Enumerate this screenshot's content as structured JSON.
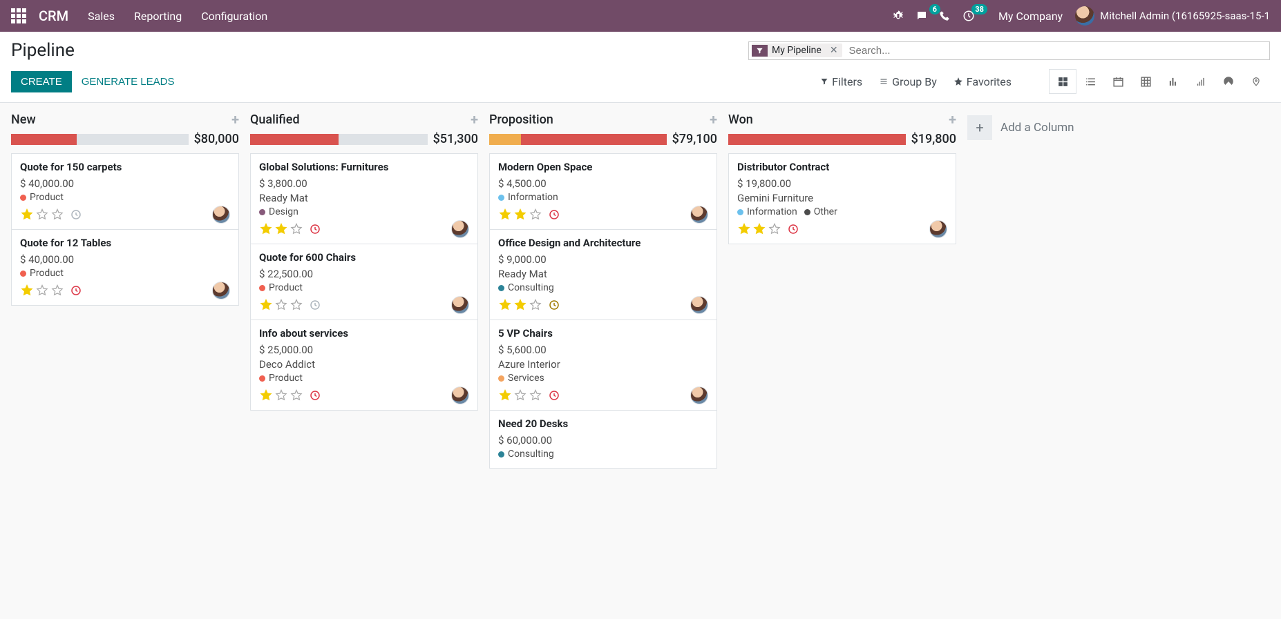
{
  "nav": {
    "brand": "CRM",
    "menus": [
      "Sales",
      "Reporting",
      "Configuration"
    ],
    "messages_badge": "6",
    "activities_badge": "38",
    "company": "My Company",
    "user": "Mitchell Admin (16165925-saas-15-1"
  },
  "control": {
    "title": "Pipeline",
    "create": "CREATE",
    "generate": "GENERATE LEADS",
    "facet_label": "My Pipeline",
    "search_placeholder": "Search...",
    "filters": "Filters",
    "groupby": "Group By",
    "favorites": "Favorites"
  },
  "add_column_label": "Add a Column",
  "tag_colors": {
    "Product": "#f06050",
    "Design": "#875a7b",
    "Information": "#6cc1ed",
    "Consulting": "#2c8397",
    "Services": "#f4a460",
    "Other": "#4c4c4c"
  },
  "columns": [
    {
      "title": "New",
      "amount": "$80,000",
      "progress": [
        {
          "color": "#d9534f",
          "pct": 37
        }
      ],
      "cards": [
        {
          "title": "Quote for 150 carpets",
          "amount": "$ 40,000.00",
          "company": null,
          "tags": [
            "Product"
          ],
          "stars": 1,
          "activity": "grey",
          "avatar": true
        },
        {
          "title": "Quote for 12 Tables",
          "amount": "$ 40,000.00",
          "company": null,
          "tags": [
            "Product"
          ],
          "stars": 1,
          "activity": "red",
          "avatar": true
        }
      ]
    },
    {
      "title": "Qualified",
      "amount": "$51,300",
      "progress": [
        {
          "color": "#d9534f",
          "pct": 50
        }
      ],
      "cards": [
        {
          "title": "Global Solutions: Furnitures",
          "amount": "$ 3,800.00",
          "company": "Ready Mat",
          "tags": [
            "Design"
          ],
          "stars": 2,
          "activity": "red",
          "avatar": true
        },
        {
          "title": "Quote for 600 Chairs",
          "amount": "$ 22,500.00",
          "company": null,
          "tags": [
            "Product"
          ],
          "stars": 1,
          "activity": "grey",
          "avatar": true
        },
        {
          "title": "Info about services",
          "amount": "$ 25,000.00",
          "company": "Deco Addict",
          "tags": [
            "Product"
          ],
          "stars": 1,
          "activity": "red",
          "avatar": true
        }
      ]
    },
    {
      "title": "Proposition",
      "amount": "$79,100",
      "progress": [
        {
          "color": "#f0ad4e",
          "pct": 18
        },
        {
          "color": "#d9534f",
          "pct": 82
        }
      ],
      "cards": [
        {
          "title": "Modern Open Space",
          "amount": "$ 4,500.00",
          "company": null,
          "tags": [
            "Information"
          ],
          "stars": 2,
          "activity": "red",
          "avatar": true
        },
        {
          "title": "Office Design and Architecture",
          "amount": "$ 9,000.00",
          "company": "Ready Mat",
          "tags": [
            "Consulting"
          ],
          "stars": 2,
          "activity": "amber",
          "avatar": true
        },
        {
          "title": "5 VP Chairs",
          "amount": "$ 5,600.00",
          "company": "Azure Interior",
          "tags": [
            "Services"
          ],
          "stars": 1,
          "activity": "red",
          "avatar": true
        },
        {
          "title": "Need 20 Desks",
          "amount": "$ 60,000.00",
          "company": null,
          "tags": [
            "Consulting"
          ],
          "stars": 0,
          "activity": null,
          "avatar": false,
          "partial": true
        }
      ]
    },
    {
      "title": "Won",
      "amount": "$19,800",
      "progress": [
        {
          "color": "#d9534f",
          "pct": 100
        }
      ],
      "cards": [
        {
          "title": "Distributor Contract",
          "amount": "$ 19,800.00",
          "company": "Gemini Furniture",
          "tags": [
            "Information",
            "Other"
          ],
          "stars": 2,
          "activity": "red",
          "avatar": true
        }
      ]
    }
  ]
}
